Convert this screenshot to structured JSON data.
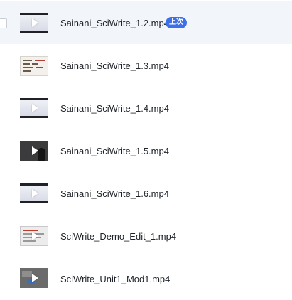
{
  "files": [
    {
      "name": "Sainani_SciWrite_1.2.mp4",
      "thumb": "video-thumbnail",
      "badge": "上次",
      "selected": true
    },
    {
      "name": "Sainani_SciWrite_1.3.mp4",
      "thumb": "document-thumbnail"
    },
    {
      "name": "Sainani_SciWrite_1.4.mp4",
      "thumb": "video-thumbnail"
    },
    {
      "name": "Sainani_SciWrite_1.5.mp4",
      "thumb": "dark-video-thumbnail"
    },
    {
      "name": "Sainani_SciWrite_1.6.mp4",
      "thumb": "video-thumbnail"
    },
    {
      "name": "SciWrite_Demo_Edit_1.mp4",
      "thumb": "slides-thumbnail"
    },
    {
      "name": "SciWrite_Unit1_Mod1.mp4",
      "thumb": "gray-video-thumbnail"
    }
  ],
  "colors": {
    "selected_row_bg": "#f2f5fa",
    "badge_bg": "#3d6fe8",
    "text": "#1f2329"
  }
}
